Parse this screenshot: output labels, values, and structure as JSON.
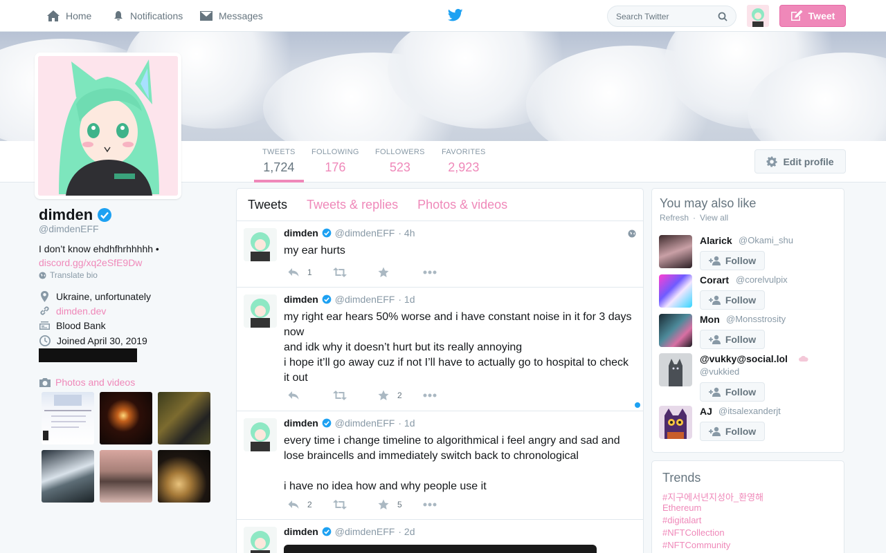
{
  "nav": {
    "home": "Home",
    "notifications": "Notifications",
    "messages": "Messages",
    "search_placeholder": "Search Twitter",
    "tweet_button": "Tweet"
  },
  "stats": [
    {
      "label": "TWEETS",
      "value": "1,724"
    },
    {
      "label": "FOLLOWING",
      "value": "176"
    },
    {
      "label": "FOLLOWERS",
      "value": "523"
    },
    {
      "label": "FAVORITES",
      "value": "2,923"
    }
  ],
  "edit_profile": "Edit profile",
  "profile": {
    "name": "dimden",
    "handle": "@dimdenEFF",
    "bio": "I don’t know ehdhfhrhhhhh •",
    "bio_link": "discord.gg/xq2eSfE9Dw",
    "translate": "Translate bio",
    "location": "Ukraine, unfortunately",
    "website": "dimden.dev",
    "blood_bank": "Blood Bank",
    "joined": "Joined April 30, 2019",
    "photos_label": "Photos and videos"
  },
  "timeline": {
    "tabs": [
      "Tweets",
      "Tweets & replies",
      "Photos & videos"
    ],
    "tweets": [
      {
        "name": "dimden",
        "handle": "@dimdenEFF",
        "time": "· 4h",
        "text": "my ear hurts",
        "replies": "1",
        "retweets": "",
        "likes": ""
      },
      {
        "name": "dimden",
        "handle": "@dimdenEFF",
        "time": "· 1d",
        "text": "my right ear hears 50% worse and i have constant noise in it for 3 days now\nand idk why it doesn’t hurt but its really annoying\ni hope it’ll go away cuz if not I’ll have to actually go to hospital to check it out",
        "replies": "",
        "retweets": "",
        "likes": "2"
      },
      {
        "name": "dimden",
        "handle": "@dimdenEFF",
        "time": "· 1d",
        "text": "every time i change timeline to algorithmical i feel angry and sad and lose braincells and immediately switch back to chronological\n\ni have no idea how and why people use it",
        "replies": "2",
        "retweets": "",
        "likes": "5"
      },
      {
        "name": "dimden",
        "handle": "@dimdenEFF",
        "time": "· 2d",
        "text": "",
        "replies": "",
        "retweets": "",
        "likes": ""
      }
    ]
  },
  "suggestions": {
    "title": "You may also like",
    "refresh": "Refresh",
    "separator": "·",
    "view_all": "View all",
    "follow_label": "Follow",
    "people": [
      {
        "name": "Alarick",
        "handle": "@Okami_shu"
      },
      {
        "name": "Corart",
        "handle": "@corelvulpix"
      },
      {
        "name": "Mon",
        "handle": "@Monsstrosity"
      },
      {
        "name": "@vukky@social.lol",
        "handle": "@vukkied"
      },
      {
        "name": "AJ",
        "handle": "@itsalexanderjt"
      }
    ]
  },
  "trends": {
    "title": "Trends",
    "items": [
      "#지구에서년지성아_환영해",
      "Ethereum",
      "#digitalart",
      "#NFTCollection",
      "#NFTCommunity"
    ]
  }
}
